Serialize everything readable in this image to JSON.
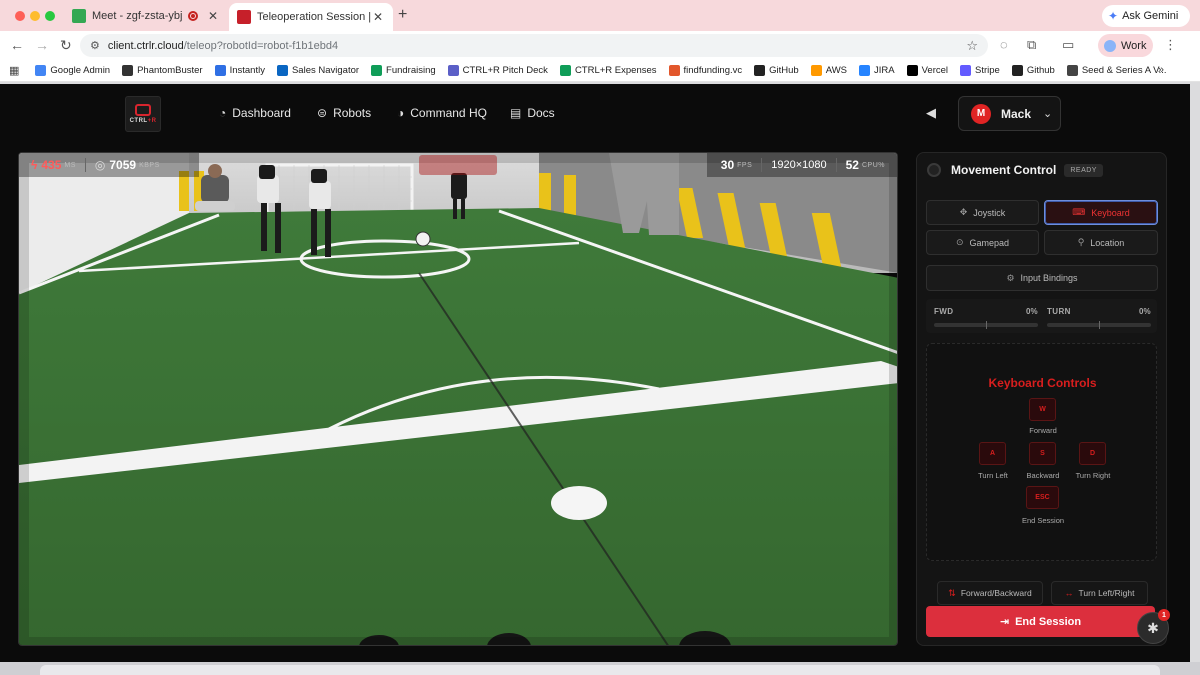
{
  "browser": {
    "tabs": [
      {
        "title": "Meet - zgf-zsta-ybj",
        "favicon_color": "#34a853"
      },
      {
        "title": "Teleoperation Session | CTRL",
        "favicon_color": "#c6202a"
      }
    ],
    "url_host": "client.ctrlr.cloud",
    "url_path": "/teleop?robotId=robot-f1b1ebd4",
    "ask_gemini": "Ask Gemini",
    "profile": "Work",
    "bookmarks": [
      {
        "label": "Google Admin",
        "color": "#4285f4"
      },
      {
        "label": "PhantomBuster",
        "color": "#333333"
      },
      {
        "label": "Instantly",
        "color": "#2f6fe4"
      },
      {
        "label": "Sales Navigator",
        "color": "#0a66c2"
      },
      {
        "label": "Fundraising",
        "color": "#0f9d58"
      },
      {
        "label": "CTRL+R Pitch Deck",
        "color": "#5b5fc7"
      },
      {
        "label": "CTRL+R Expenses",
        "color": "#0f9d58"
      },
      {
        "label": "findfunding.vc",
        "color": "#e2572c"
      },
      {
        "label": "GitHub",
        "color": "#222222"
      },
      {
        "label": "AWS",
        "color": "#f90"
      },
      {
        "label": "JIRA",
        "color": "#2684ff"
      },
      {
        "label": "Vercel",
        "color": "#000000"
      },
      {
        "label": "Stripe",
        "color": "#635bff"
      },
      {
        "label": "Github",
        "color": "#222222"
      },
      {
        "label": "Seed & Series A V...",
        "color": "#444444"
      }
    ]
  },
  "app": {
    "logo_text_a": "CTRL",
    "logo_text_b": "+R",
    "nav": [
      {
        "label": "Dashboard",
        "icon": "dashboard-icon"
      },
      {
        "label": "Robots",
        "icon": "robot-icon"
      },
      {
        "label": "Command HQ",
        "icon": "command-icon"
      },
      {
        "label": "Docs",
        "icon": "docs-icon"
      }
    ],
    "user": {
      "initial": "M",
      "name": "Mack"
    }
  },
  "video": {
    "latency_value": "435",
    "latency_unit": "MS",
    "bitrate_value": "7059",
    "bitrate_unit": "KBPS",
    "fps_value": "30",
    "fps_unit": "FPS",
    "resolution": "1920×1080",
    "cpu_value": "52",
    "cpu_unit": "CPU%"
  },
  "control": {
    "title": "Movement Control",
    "status": "READY",
    "modes": [
      {
        "label": "Joystick",
        "icon": "move-icon",
        "active": false
      },
      {
        "label": "Keyboard",
        "icon": "keyboard-icon",
        "active": true
      },
      {
        "label": "Gamepad",
        "icon": "gamepad-icon",
        "active": false
      },
      {
        "label": "Location",
        "icon": "location-pin-icon",
        "active": false
      }
    ],
    "input_bindings": "Input Bindings",
    "fwd_label": "FWD",
    "fwd_value": "0%",
    "turn_label": "TURN",
    "turn_value": "0%",
    "keyboard_title": "Keyboard Controls",
    "keys": [
      {
        "key": "W",
        "label": "Forward"
      },
      {
        "key": "A",
        "label": "Turn Left"
      },
      {
        "key": "S",
        "label": "Backward"
      },
      {
        "key": "D",
        "label": "Turn Right"
      },
      {
        "key": "ESC",
        "label": "End Session"
      }
    ],
    "legend_fb": "Forward/Backward",
    "legend_lr": "Turn Left/Right",
    "end_session": "End Session",
    "notification_count": "1",
    "accent": "#dc2f3d"
  }
}
